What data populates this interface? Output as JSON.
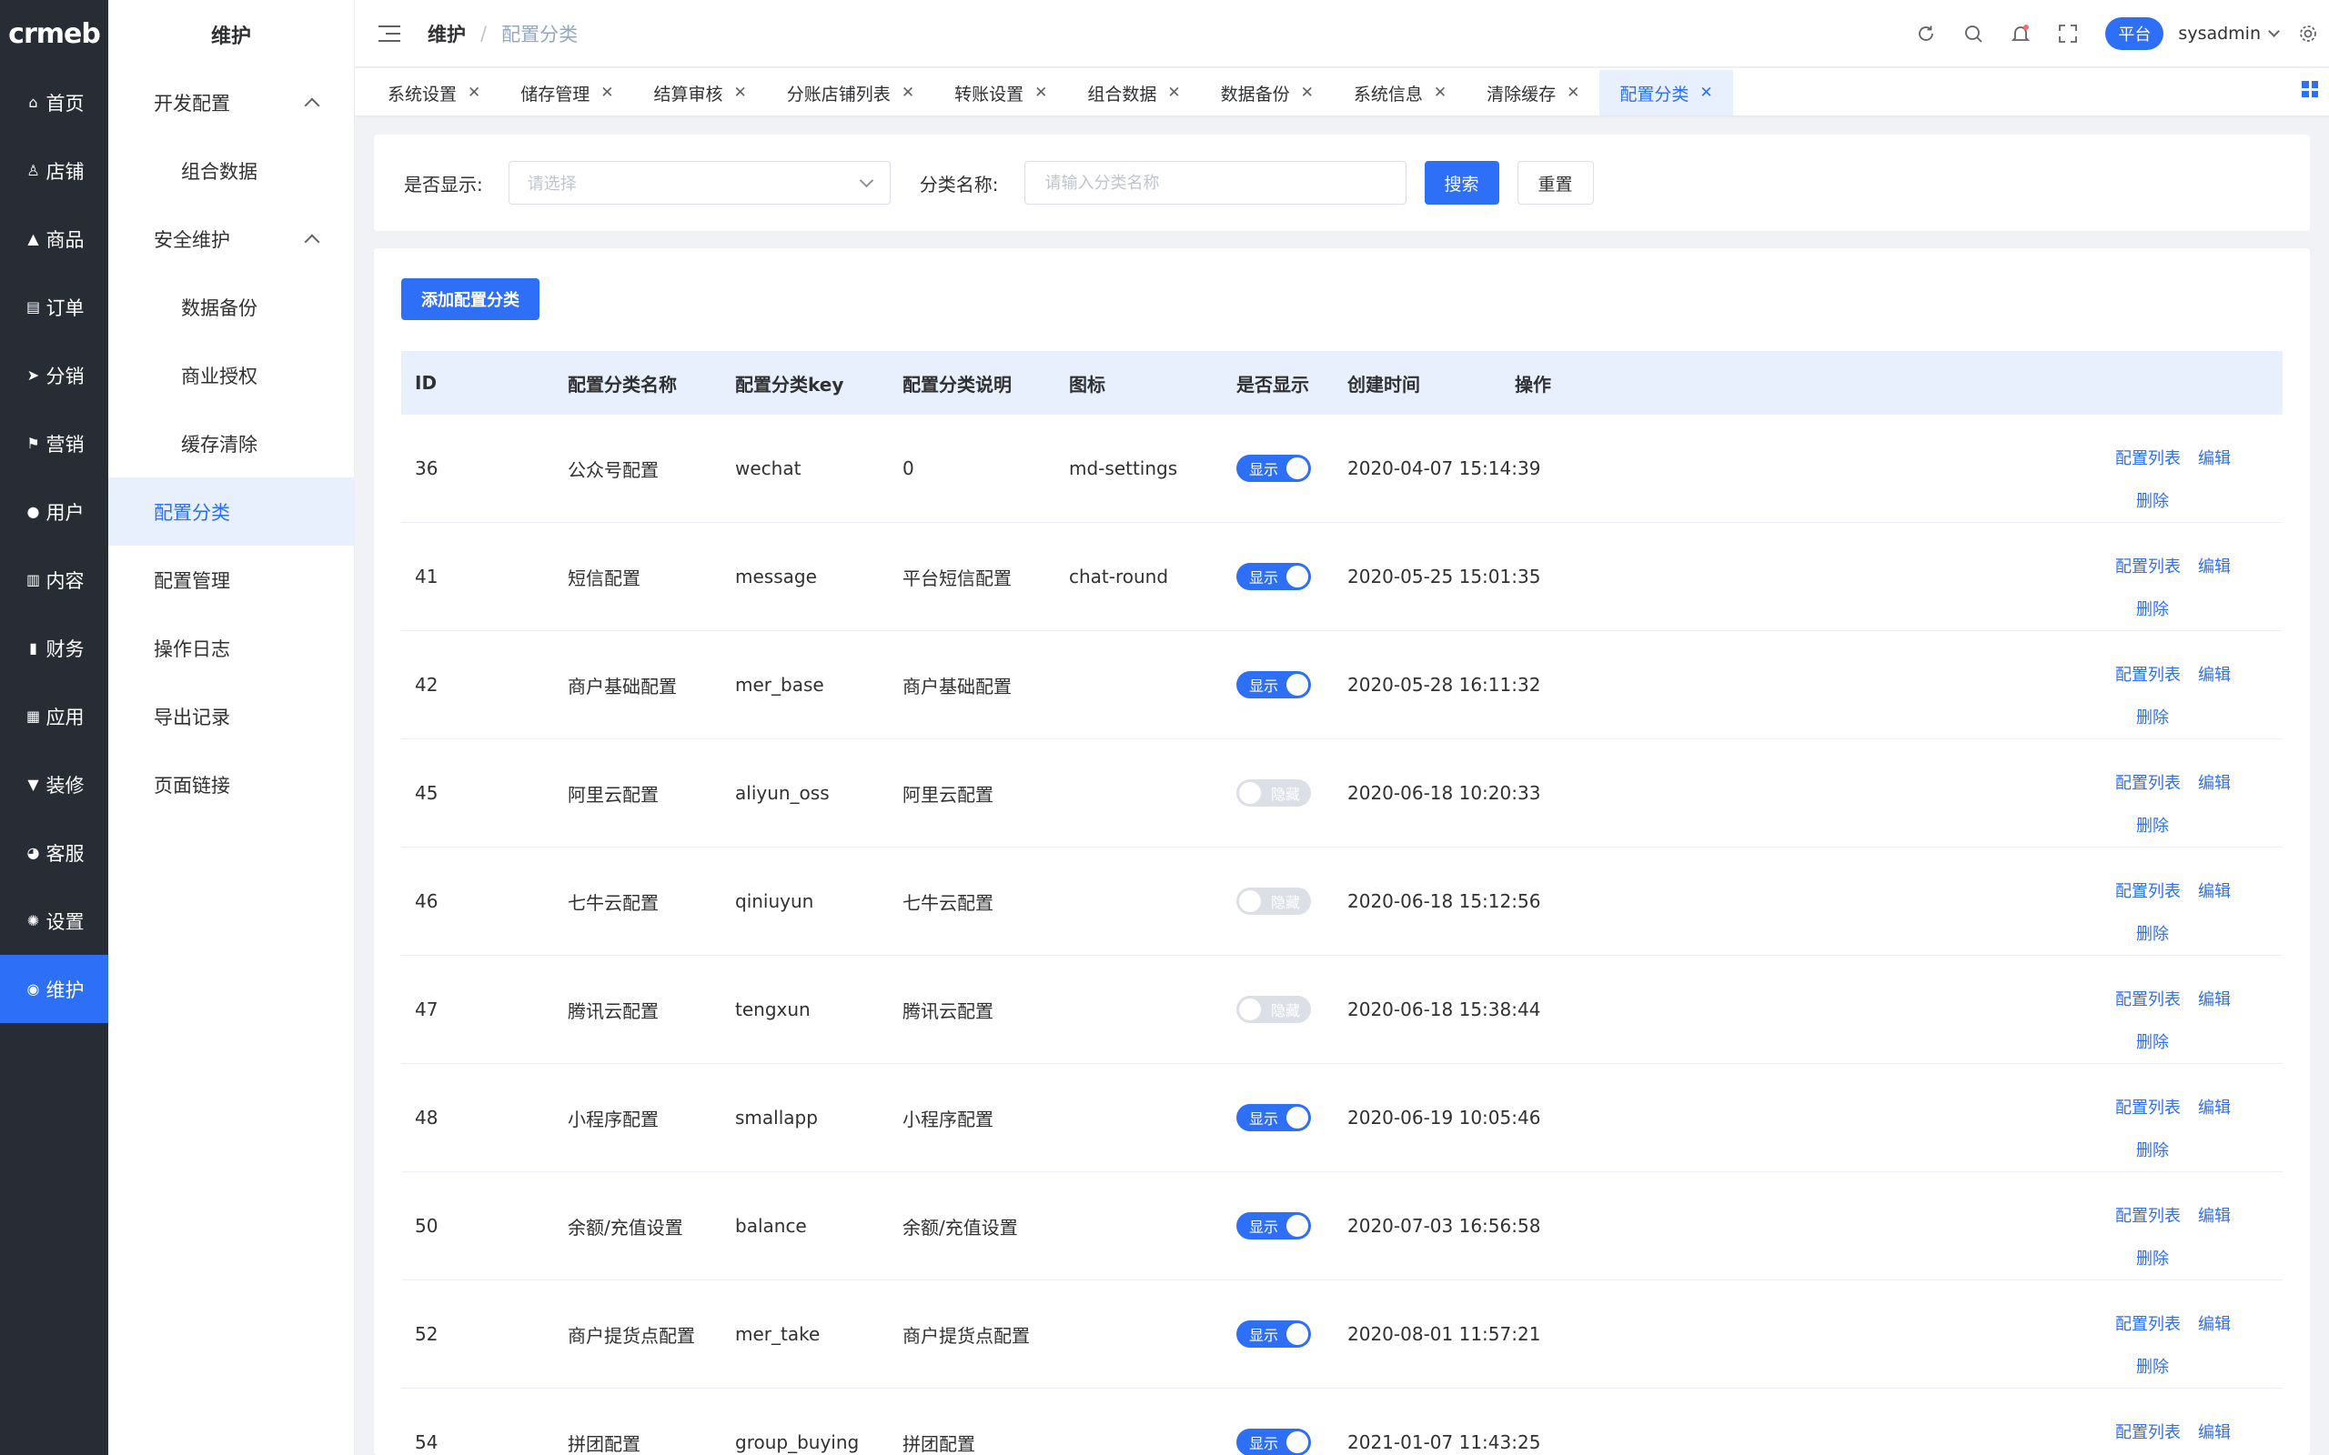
{
  "logo": "crmeb",
  "primary_nav": [
    {
      "label": "首页",
      "icon": "home-icon"
    },
    {
      "label": "店铺",
      "icon": "store-icon"
    },
    {
      "label": "商品",
      "icon": "goods-icon"
    },
    {
      "label": "订单",
      "icon": "order-icon"
    },
    {
      "label": "分销",
      "icon": "distribution-icon"
    },
    {
      "label": "营销",
      "icon": "flag-icon"
    },
    {
      "label": "用户",
      "icon": "user-icon"
    },
    {
      "label": "内容",
      "icon": "content-icon"
    },
    {
      "label": "财务",
      "icon": "chart-icon"
    },
    {
      "label": "应用",
      "icon": "apps-icon"
    },
    {
      "label": "装修",
      "icon": "brush-icon"
    },
    {
      "label": "客服",
      "icon": "support-icon"
    },
    {
      "label": "设置",
      "icon": "gear-icon"
    },
    {
      "label": "维护",
      "icon": "maintain-icon",
      "active": true
    }
  ],
  "secondary_nav": {
    "title": "维护",
    "items": [
      {
        "label": "开发配置",
        "type": "group"
      },
      {
        "label": "组合数据",
        "type": "child"
      },
      {
        "label": "安全维护",
        "type": "group"
      },
      {
        "label": "数据备份",
        "type": "child"
      },
      {
        "label": "商业授权",
        "type": "child"
      },
      {
        "label": "缓存清除",
        "type": "child"
      },
      {
        "label": "配置分类",
        "type": "leaf",
        "active": true
      },
      {
        "label": "配置管理",
        "type": "leaf"
      },
      {
        "label": "操作日志",
        "type": "leaf"
      },
      {
        "label": "导出记录",
        "type": "leaf"
      },
      {
        "label": "页面链接",
        "type": "leaf"
      }
    ]
  },
  "header": {
    "breadcrumb": [
      "维护",
      "配置分类"
    ],
    "separator": "/",
    "platform_label": "平台",
    "username": "sysadmin"
  },
  "tabs": [
    {
      "label": "系统设置"
    },
    {
      "label": "储存管理"
    },
    {
      "label": "结算审核"
    },
    {
      "label": "分账店铺列表"
    },
    {
      "label": "转账设置"
    },
    {
      "label": "组合数据"
    },
    {
      "label": "数据备份"
    },
    {
      "label": "系统信息"
    },
    {
      "label": "清除缓存"
    },
    {
      "label": "配置分类",
      "active": true
    }
  ],
  "filter": {
    "show_label": "是否显示:",
    "show_placeholder": "请选择",
    "name_label": "分类名称:",
    "name_placeholder": "请输入分类名称",
    "search_button": "搜索",
    "reset_button": "重置"
  },
  "add_button": "添加配置分类",
  "table": {
    "columns": [
      "ID",
      "配置分类名称",
      "配置分类key",
      "配置分类说明",
      "图标",
      "是否显示",
      "创建时间",
      "操作"
    ],
    "show_on_text": "显示",
    "show_off_text": "隐藏",
    "op_list": "配置列表",
    "op_edit": "编辑",
    "op_delete": "删除",
    "rows": [
      {
        "id": "36",
        "name": "公众号配置",
        "key": "wechat",
        "desc": "0",
        "icon": "md-settings",
        "show": true,
        "created": "2020-04-07 15:14:39"
      },
      {
        "id": "41",
        "name": "短信配置",
        "key": "message",
        "desc": "平台短信配置",
        "icon": "chat-round",
        "show": true,
        "created": "2020-05-25 15:01:35"
      },
      {
        "id": "42",
        "name": "商户基础配置",
        "key": "mer_base",
        "desc": "商户基础配置",
        "icon": "",
        "show": true,
        "created": "2020-05-28 16:11:32"
      },
      {
        "id": "45",
        "name": "阿里云配置",
        "key": "aliyun_oss",
        "desc": "阿里云配置",
        "icon": "",
        "show": false,
        "created": "2020-06-18 10:20:33"
      },
      {
        "id": "46",
        "name": "七牛云配置",
        "key": "qiniuyun",
        "desc": "七牛云配置",
        "icon": "",
        "show": false,
        "created": "2020-06-18 15:12:56"
      },
      {
        "id": "47",
        "name": "腾讯云配置",
        "key": "tengxun",
        "desc": "腾讯云配置",
        "icon": "",
        "show": false,
        "created": "2020-06-18 15:38:44"
      },
      {
        "id": "48",
        "name": "小程序配置",
        "key": "smallapp",
        "desc": "小程序配置",
        "icon": "",
        "show": true,
        "created": "2020-06-19 10:05:46"
      },
      {
        "id": "50",
        "name": "余额/充值设置",
        "key": "balance",
        "desc": "余额/充值设置",
        "icon": "",
        "show": true,
        "created": "2020-07-03 16:56:58"
      },
      {
        "id": "52",
        "name": "商户提货点配置",
        "key": "mer_take",
        "desc": "商户提货点配置",
        "icon": "",
        "show": true,
        "created": "2020-08-01 11:57:21"
      },
      {
        "id": "54",
        "name": "拼团配置",
        "key": "group_buying",
        "desc": "拼团配置",
        "icon": "",
        "show": true,
        "created": "2021-01-07 11:43:25"
      }
    ]
  },
  "colors": {
    "primary": "#2d6ff7",
    "sidebar_dark": "#282c34",
    "header_bg_light": "#e8f0fe"
  }
}
